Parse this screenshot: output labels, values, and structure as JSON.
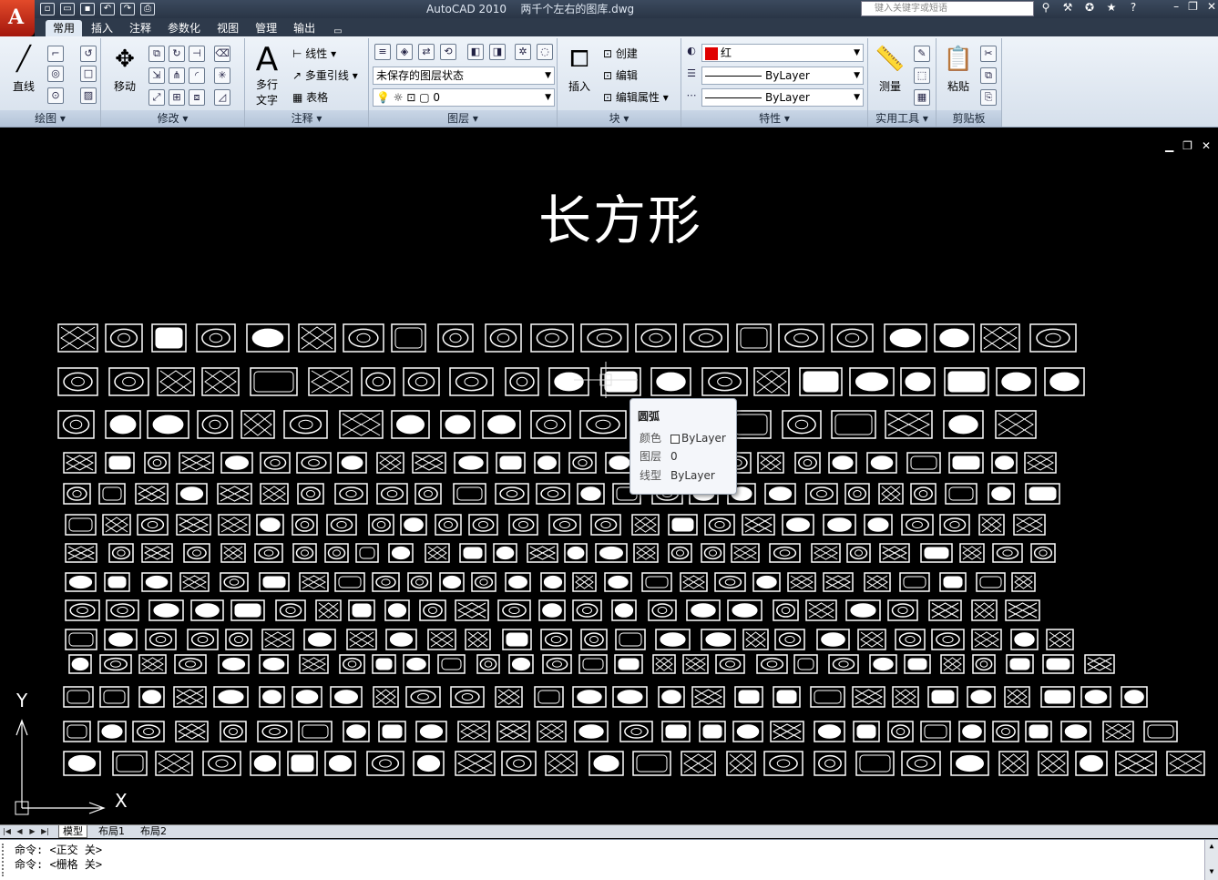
{
  "app": {
    "title": "AutoCAD 2010",
    "document": "两千个左右的图库.dwg",
    "search_placeholder": "键入关键字或短语",
    "logo_letter": "A"
  },
  "qat_icons": [
    "new-icon",
    "open-icon",
    "save-icon",
    "undo-icon",
    "redo-icon",
    "print-icon"
  ],
  "tabs": [
    {
      "label": "常用",
      "active": true
    },
    {
      "label": "插入"
    },
    {
      "label": "注释"
    },
    {
      "label": "参数化"
    },
    {
      "label": "视图"
    },
    {
      "label": "管理"
    },
    {
      "label": "输出"
    }
  ],
  "ribbon": {
    "draw": {
      "label": "绘图",
      "line": "直线"
    },
    "modify": {
      "label": "修改",
      "move": "移动"
    },
    "annotate": {
      "label": "注释",
      "mtext_1": "多行",
      "mtext_2": "文字",
      "linear": "线性",
      "mleader": "多重引线",
      "table": "表格"
    },
    "layers": {
      "label": "图层",
      "state": "未保存的图层状态",
      "current": "0"
    },
    "block": {
      "label": "块",
      "insert": "插入",
      "create": "创建",
      "edit": "编辑",
      "edit_attr": "编辑属性"
    },
    "properties": {
      "label": "特性",
      "color": "红",
      "linetype": "ByLayer",
      "lineweight": "ByLayer"
    },
    "utilities": {
      "label": "实用工具",
      "measure": "测量"
    },
    "clipboard": {
      "label": "剪贴板",
      "paste": "粘贴"
    }
  },
  "drawing": {
    "title": "长方形",
    "ucs_x": "X",
    "ucs_y": "Y"
  },
  "tooltip": {
    "title": "圆弧",
    "rows": [
      {
        "key": "颜色",
        "value": "ByLayer"
      },
      {
        "key": "图层",
        "value": "0"
      },
      {
        "key": "线型",
        "value": "ByLayer"
      }
    ]
  },
  "layout_tabs": [
    {
      "label": "模型",
      "active": true
    },
    {
      "label": "布局1"
    },
    {
      "label": "布局2"
    }
  ],
  "command_lines": [
    "命令:  <正交 关>",
    "命令:  <栅格 关>"
  ],
  "colors": {
    "background": "#000000",
    "accent_red": "#e00000",
    "ribbon": "#dfe8f3"
  }
}
